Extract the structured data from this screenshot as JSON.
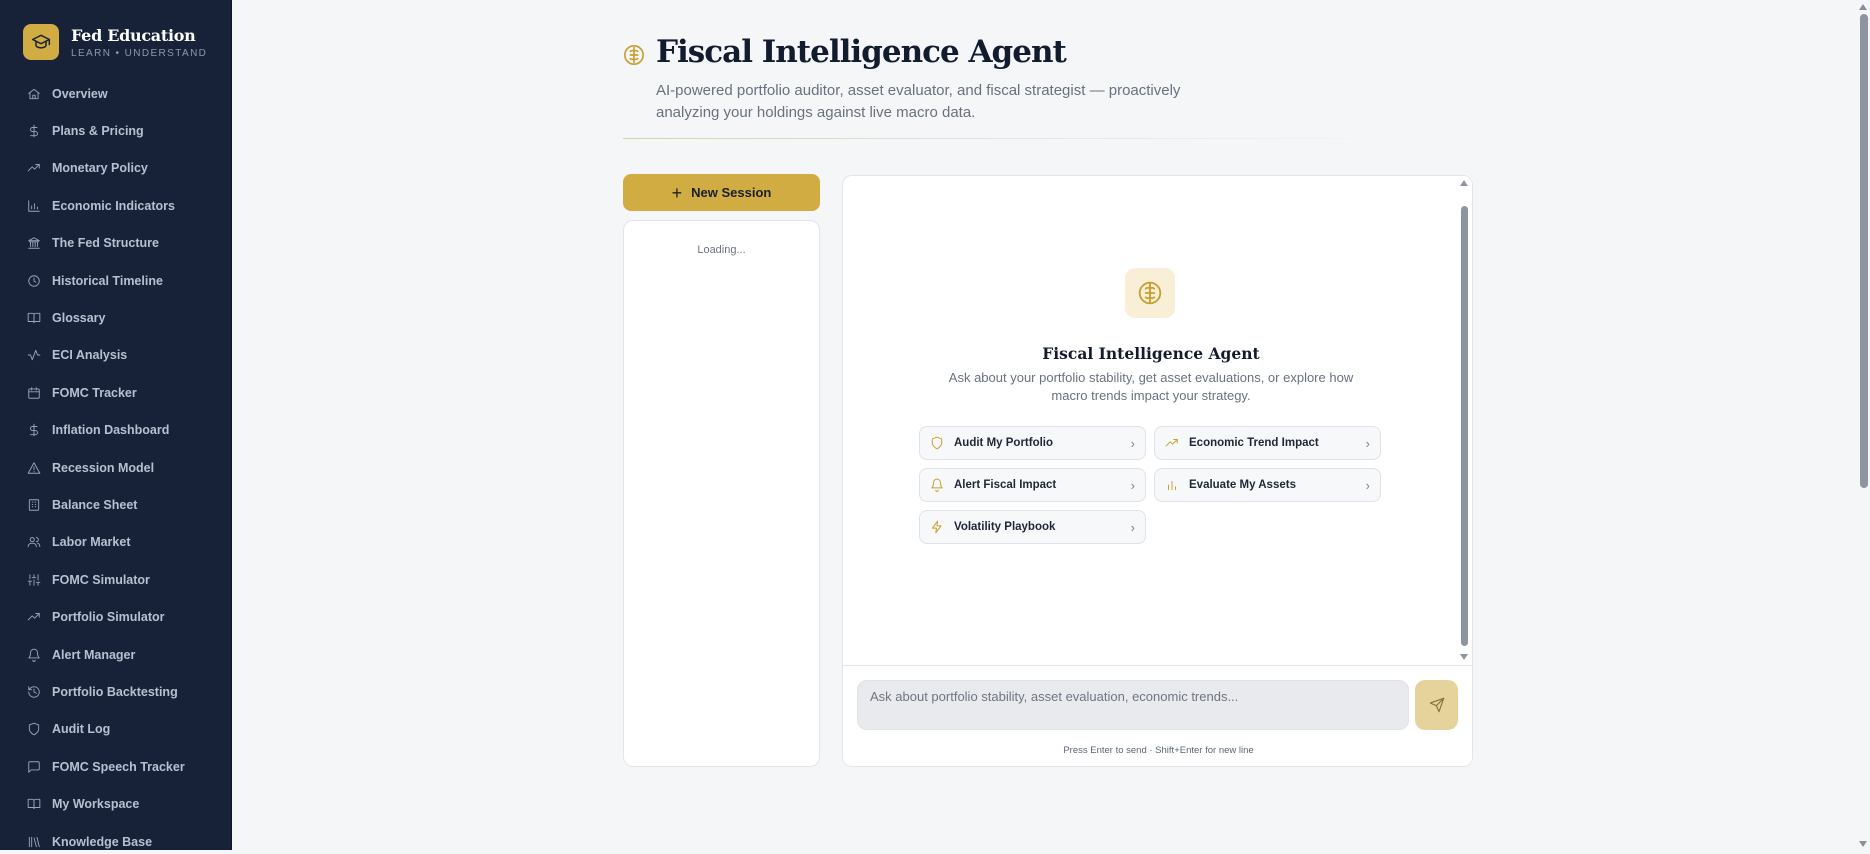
{
  "brand": {
    "title": "Fed Education",
    "subtitle": "LEARN • UNDERSTAND",
    "accent_color": "#d1ac42",
    "logo_icon": "graduation-cap-icon"
  },
  "sidebar": {
    "items": [
      {
        "label": "Overview",
        "icon": "home-icon"
      },
      {
        "label": "Plans & Pricing",
        "icon": "dollar-icon"
      },
      {
        "label": "Monetary Policy",
        "icon": "trending-up-icon"
      },
      {
        "label": "Economic Indicators",
        "icon": "bar-chart-icon"
      },
      {
        "label": "The Fed Structure",
        "icon": "landmark-icon"
      },
      {
        "label": "Historical Timeline",
        "icon": "clock-icon"
      },
      {
        "label": "Glossary",
        "icon": "book-icon"
      },
      {
        "label": "ECI Analysis",
        "icon": "activity-icon"
      },
      {
        "label": "FOMC Tracker",
        "icon": "calendar-icon"
      },
      {
        "label": "Inflation Dashboard",
        "icon": "dollar-icon"
      },
      {
        "label": "Recession Model",
        "icon": "warning-icon"
      },
      {
        "label": "Balance Sheet",
        "icon": "building-icon"
      },
      {
        "label": "Labor Market",
        "icon": "users-icon"
      },
      {
        "label": "FOMC Simulator",
        "icon": "sliders-icon"
      },
      {
        "label": "Portfolio Simulator",
        "icon": "trending-up-icon"
      },
      {
        "label": "Alert Manager",
        "icon": "bell-icon"
      },
      {
        "label": "Portfolio Backtesting",
        "icon": "history-icon"
      },
      {
        "label": "Audit Log",
        "icon": "shield-icon"
      },
      {
        "label": "FOMC Speech Tracker",
        "icon": "message-icon"
      },
      {
        "label": "My Workspace",
        "icon": "book-open-icon"
      },
      {
        "label": "Knowledge Base",
        "icon": "library-icon"
      }
    ]
  },
  "header": {
    "title": "Fiscal Intelligence Agent",
    "subtitle": "AI-powered portfolio auditor, asset evaluator, and fiscal strategist — proactively analyzing your holdings against live macro data.",
    "icon": "brain-icon"
  },
  "sessions": {
    "new_label": "New Session",
    "loading_text": "Loading..."
  },
  "chat": {
    "welcome_title": "Fiscal Intelligence Agent",
    "welcome_text": "Ask about your portfolio stability, get asset evaluations, or explore how macro trends impact your strategy.",
    "suggestions": [
      {
        "label": "Audit My Portfolio",
        "icon": "shield-icon"
      },
      {
        "label": "Economic Trend Impact",
        "icon": "trending-up-icon"
      },
      {
        "label": "Alert Fiscal Impact",
        "icon": "bell-icon"
      },
      {
        "label": "Evaluate My Assets",
        "icon": "bar-chart-icon"
      },
      {
        "label": "Volatility Playbook",
        "icon": "zap-icon"
      }
    ],
    "input_placeholder": "Ask about portfolio stability, asset evaluation, economic trends...",
    "input_value": "",
    "hint": "Press Enter to send · Shift+Enter for new line",
    "send_icon": "send-icon"
  }
}
